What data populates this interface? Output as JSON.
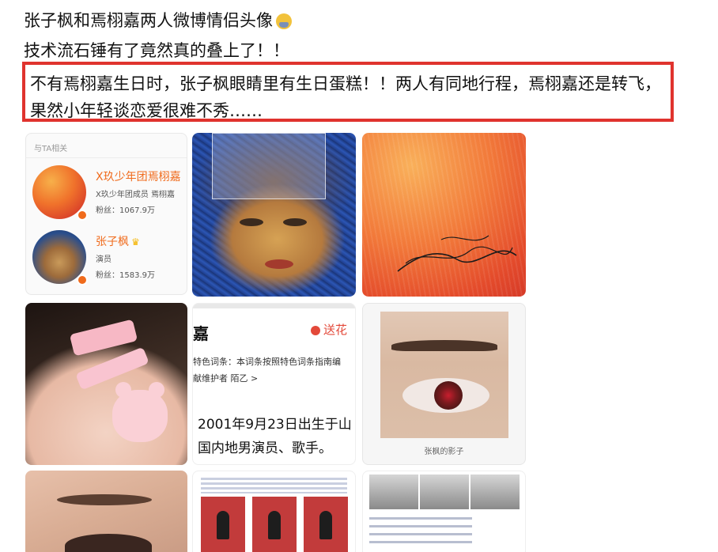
{
  "post": {
    "line1": "张子枫和焉栩嘉两人微博情侣头像",
    "line2": "技术流石锤有了竟然真的叠上了！！",
    "highlight_line1": "不有焉栩嘉生日时，张子枫眼睛里有生日蛋糕！！两人有同地行程，焉栩嘉还是转飞，",
    "highlight_line2": "果然小年轻谈恋爱很难不秀……",
    "highlight_color": "#e0332e"
  },
  "related_card": {
    "title": "与TA相关",
    "people": [
      {
        "name": "X玖少年团焉栩嘉",
        "desc": "X玖少年团成员 焉栩嘉",
        "fans": "粉丝：1067.9万"
      },
      {
        "name": "张子枫",
        "desc": "演员",
        "fans": "粉丝：1583.9万"
      }
    ],
    "accent_color": "#f06b1c"
  },
  "baike": {
    "heading": "嘉",
    "flower_button": "送花",
    "feature_line": "特色词条：本词条按照特色词条指南编",
    "maintainer_line": "献维护者 陌乙 >",
    "desc_line1": "2001年9月23日出生于山",
    "desc_line2": "国内地男演员、歌手。"
  },
  "eye_tile": {
    "caption": "张枫的影子"
  },
  "icons": [
    "emoji-icon",
    "crown-icon",
    "verified-badge-icon",
    "flower-icon"
  ]
}
